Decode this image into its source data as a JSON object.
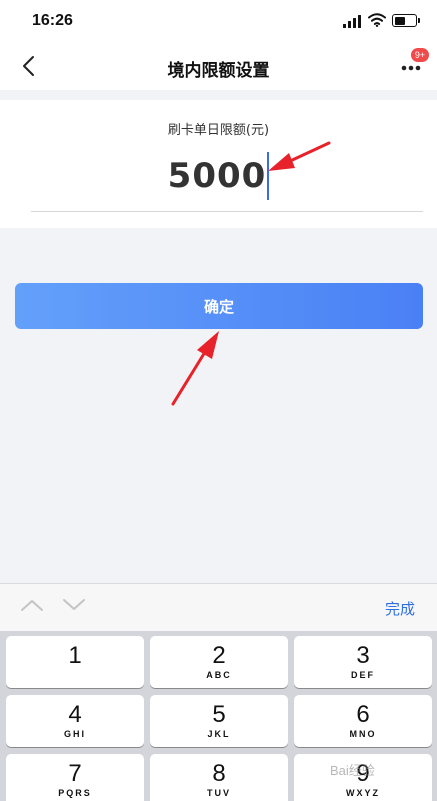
{
  "status_bar": {
    "time": "16:26",
    "battery_level": 0.55
  },
  "nav": {
    "title": "境内限额设置",
    "badge": "9+"
  },
  "limit": {
    "label": "刷卡单日限额(元)",
    "amount": "5000"
  },
  "confirm": {
    "label": "确定"
  },
  "keyboard": {
    "done_label": "完成",
    "keys": [
      {
        "digit": "1",
        "letters": ""
      },
      {
        "digit": "2",
        "letters": "ABC"
      },
      {
        "digit": "3",
        "letters": "DEF"
      },
      {
        "digit": "4",
        "letters": "GHI"
      },
      {
        "digit": "5",
        "letters": "JKL"
      },
      {
        "digit": "6",
        "letters": "MNO"
      },
      {
        "digit": "7",
        "letters": "PQRS"
      },
      {
        "digit": "8",
        "letters": "TUV"
      },
      {
        "digit": "9",
        "letters": "WXYZ"
      }
    ]
  },
  "watermark": {
    "text": "Bai经验"
  },
  "colors": {
    "accent": "#4a80f5",
    "annotation": "#e8222a",
    "badge": "#f04a4a"
  }
}
